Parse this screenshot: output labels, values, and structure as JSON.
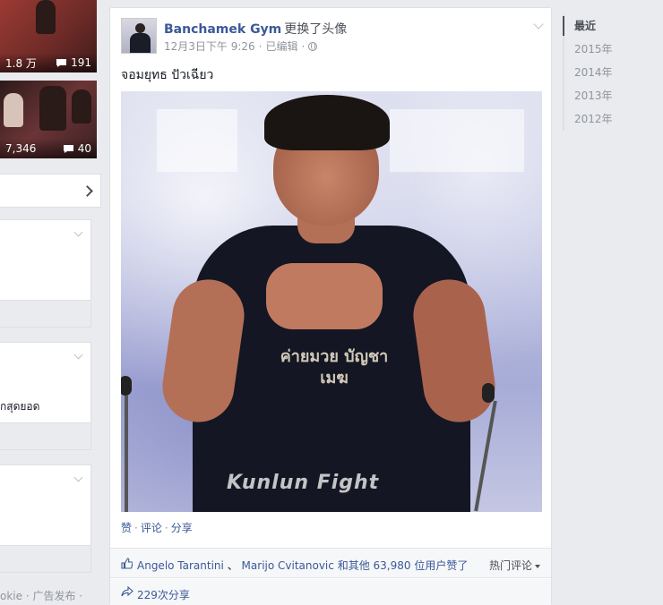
{
  "left": {
    "thumb1": {
      "views": "1.8 万",
      "comments": "191"
    },
    "thumb2": {
      "views": "7,346",
      "comments": "40"
    },
    "card2_text": "กสุดยอด",
    "bottom_text": "okie · 广告发布 ·"
  },
  "post": {
    "page_name": "Banchamek Gym",
    "action": "更换了头像",
    "timestamp": "12月3日下午 9:26",
    "edited": "已编辑",
    "text": "จอมยุทธ ปัวเฉียว",
    "photo": {
      "shirt_text": "ค่ายมวย บัญชาเมฆ",
      "watermark": "Kunlun Fight"
    },
    "actions": {
      "like": "赞",
      "comment": "评论",
      "share": "分享"
    },
    "likes": {
      "name1": "Angelo Tarantini",
      "separator": "、",
      "name2": "Marijo Cvitanovic",
      "rest": "和其他 63,980 位用户赞了"
    },
    "top_comments": "热门评论",
    "shares": "229次分享"
  },
  "timeline": {
    "items": [
      "最近",
      "2015年",
      "2014年",
      "2013年",
      "2012年"
    ]
  },
  "colors": {
    "link": "#3b5998",
    "muted": "#90949c",
    "bg": "#e9ebee"
  }
}
